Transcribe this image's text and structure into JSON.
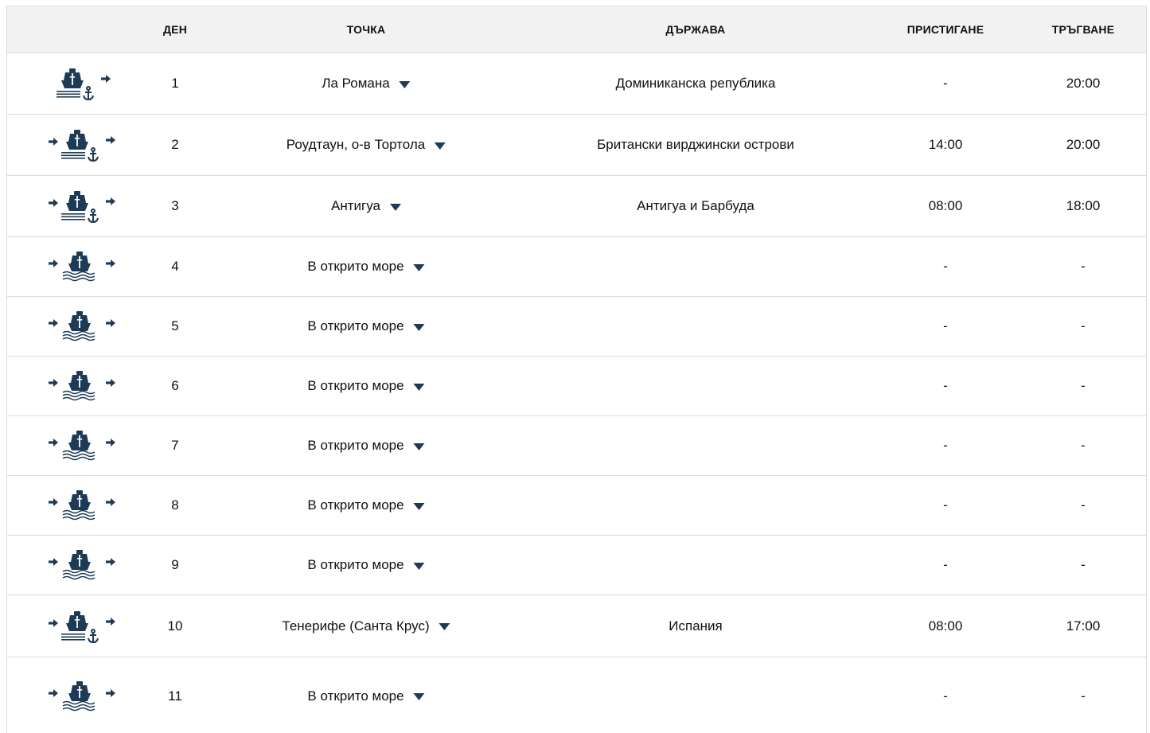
{
  "colors": {
    "icon": "#1d3b57",
    "header_bg": "#f2f2f2",
    "border": "#dcdcdc"
  },
  "header": {
    "col_icon": "",
    "col_day": "ДЕН",
    "col_port": "ТОЧКА",
    "col_country": "ДЪРЖАВА",
    "col_arrival": "ПРИСТИГАНЕ",
    "col_departure": "ТРЪГВАНЕ"
  },
  "rows": [
    {
      "day": "1",
      "port": "Ла Романа",
      "country": "Доминиканска република",
      "arrival": "-",
      "departure": "20:00",
      "icon": "embark-port-icon"
    },
    {
      "day": "2",
      "port": "Роудтаун, о-в Тортола",
      "country": "Британски вирджински острови",
      "arrival": "14:00",
      "departure": "20:00",
      "icon": "port-stop-icon"
    },
    {
      "day": "3",
      "port": "Антигуа",
      "country": "Антигуа и Барбуда",
      "arrival": "08:00",
      "departure": "18:00",
      "icon": "port-stop-icon"
    },
    {
      "day": "4",
      "port": "В открито море",
      "country": "",
      "arrival": "-",
      "departure": "-",
      "icon": "at-sea-icon"
    },
    {
      "day": "5",
      "port": "В открито море",
      "country": "",
      "arrival": "-",
      "departure": "-",
      "icon": "at-sea-icon"
    },
    {
      "day": "6",
      "port": "В открито море",
      "country": "",
      "arrival": "-",
      "departure": "-",
      "icon": "at-sea-icon"
    },
    {
      "day": "7",
      "port": "В открито море",
      "country": "",
      "arrival": "-",
      "departure": "-",
      "icon": "at-sea-icon"
    },
    {
      "day": "8",
      "port": "В открито море",
      "country": "",
      "arrival": "-",
      "departure": "-",
      "icon": "at-sea-icon"
    },
    {
      "day": "9",
      "port": "В открито море",
      "country": "",
      "arrival": "-",
      "departure": "-",
      "icon": "at-sea-icon"
    },
    {
      "day": "10",
      "port": "Тенерифе (Санта Крус)",
      "country": "Испания",
      "arrival": "08:00",
      "departure": "17:00",
      "icon": "port-stop-icon"
    },
    {
      "day": "11",
      "port": "В открито море",
      "country": "",
      "arrival": "-",
      "departure": "-",
      "icon": "at-sea-icon"
    }
  ]
}
